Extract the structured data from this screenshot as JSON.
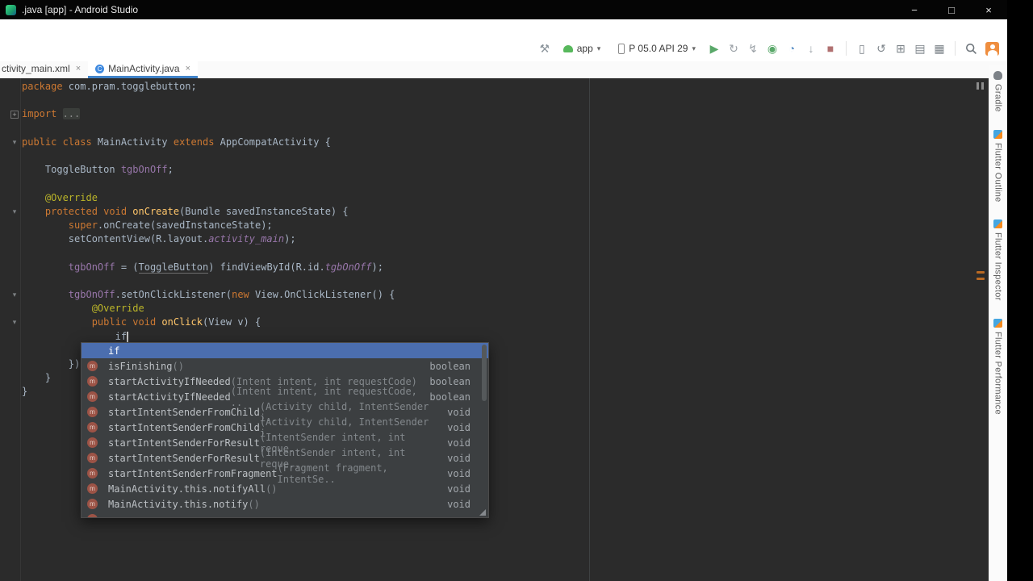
{
  "colors": {
    "editor_bg": "#2b2b2b",
    "popup_bg": "#3c3f41",
    "selection_blue": "#4b6eaf",
    "keyword_orange": "#cc7832",
    "field_purple": "#9876aa",
    "annotation_yellow": "#bbb529",
    "run_green": "#59a869",
    "tab_accent": "#4083c9"
  },
  "titlebar": {
    "title": ".java [app] - Android Studio",
    "minimize": "−",
    "maximize": "□",
    "close": "×"
  },
  "toolbar": {
    "dropdown_arrow": "▾",
    "run_config_label": "app",
    "device_label": "P 05.0 API 29",
    "build": [
      {
        "name": "build-icon",
        "glyph": "⚒",
        "color": "#8b949b"
      }
    ],
    "actions": [
      {
        "name": "run-button",
        "glyph": "▶",
        "color": "#59a869"
      },
      {
        "name": "apply-changes-button",
        "glyph": "↻",
        "color": "#9aa0a6"
      },
      {
        "name": "apply-code-changes-button",
        "glyph": "↯",
        "color": "#9aa0a6"
      },
      {
        "name": "debug-button",
        "glyph": "◉",
        "color": "#59a869"
      },
      {
        "name": "profile-button",
        "glyph": "◔",
        "color": "#6c9ccd"
      },
      {
        "name": "attach-debugger-button",
        "glyph": "↓",
        "color": "#9aa0a6"
      },
      {
        "name": "stop-button",
        "glyph": "■",
        "color": "#b07070"
      }
    ],
    "tools": [
      {
        "name": "avd-manager-button",
        "glyph": "▯",
        "color": "#7d848a"
      },
      {
        "name": "sync-project-button",
        "glyph": "↺",
        "color": "#7d848a"
      },
      {
        "name": "sdk-manager-button",
        "glyph": "⊞",
        "color": "#7d848a"
      },
      {
        "name": "layout-inspector-button",
        "glyph": "▤",
        "color": "#7d848a"
      },
      {
        "name": "resource-manager-button",
        "glyph": "▦",
        "color": "#7d848a"
      }
    ]
  },
  "tabs": [
    {
      "label": "ctivity_main.xml",
      "close": "×",
      "selected": false
    },
    {
      "label": "MainActivity.java",
      "close": "×",
      "selected": true,
      "icon": "java-class-icon",
      "icon_letter": "C"
    }
  ],
  "editor": {
    "lines": [
      [
        [
          "kw",
          "package "
        ],
        [
          "pl",
          "com.pram.togglebutton;"
        ]
      ],
      [],
      [
        [
          "kw",
          "import "
        ],
        [
          "fold",
          "..."
        ]
      ],
      [],
      [
        [
          "kw",
          "public class "
        ],
        [
          "pl",
          "MainActivity "
        ],
        [
          "kw",
          "extends "
        ],
        [
          "pl",
          "AppCompatActivity {"
        ]
      ],
      [],
      [
        [
          "pl",
          "    ToggleButton "
        ],
        [
          "fld",
          "tgbOnOff"
        ],
        [
          "pl",
          ";"
        ]
      ],
      [],
      [
        [
          "ann",
          "    @Override"
        ]
      ],
      [
        [
          "kw",
          "    protected void "
        ],
        [
          "mth",
          "onCreate"
        ],
        [
          "pl",
          "(Bundle savedInstanceState) {"
        ]
      ],
      [
        [
          "kw",
          "        super"
        ],
        [
          "pl",
          ".onCreate(savedInstanceState);"
        ]
      ],
      [
        [
          "pl",
          "        setContentView(R.layout."
        ],
        [
          "sf",
          "activity_main"
        ],
        [
          "pl",
          ");"
        ]
      ],
      [],
      [
        [
          "fld",
          "        tgbOnOff"
        ],
        [
          "pl",
          " = ("
        ],
        [
          "cast",
          "ToggleButton"
        ],
        [
          "pl",
          ") findViewById(R.id."
        ],
        [
          "sf",
          "tgbOnOff"
        ],
        [
          "pl",
          ");"
        ]
      ],
      [],
      [
        [
          "fld",
          "        tgbOnOff"
        ],
        [
          "pl",
          ".setOnClickListener("
        ],
        [
          "kw",
          "new "
        ],
        [
          "pl",
          "View.OnClickListener() {"
        ]
      ],
      [
        [
          "ann",
          "            @Override"
        ]
      ],
      [
        [
          "kw",
          "            public void "
        ],
        [
          "mth",
          "onClick"
        ],
        [
          "pl",
          "(View v) {"
        ]
      ],
      [
        [
          "pl",
          "                if"
        ],
        [
          "caret",
          ""
        ]
      ],
      [
        [
          "pl",
          "            }"
        ]
      ],
      [
        [
          "pl",
          "        });"
        ]
      ],
      [
        [
          "pl",
          "    }"
        ]
      ],
      [
        [
          "pl",
          "}"
        ]
      ]
    ],
    "folds": [
      {
        "line": 3,
        "kind": "plus"
      },
      {
        "line": 5,
        "kind": "arrow"
      },
      {
        "line": 10,
        "kind": "arrow"
      },
      {
        "line": 16,
        "kind": "arrow"
      },
      {
        "line": 18,
        "kind": "arrow"
      }
    ]
  },
  "completion": {
    "rows": [
      {
        "selected": true,
        "icon": "none",
        "name": "if",
        "params": "",
        "type": ""
      },
      {
        "selected": false,
        "icon": "method",
        "name": "isFinishing",
        "params": "()",
        "type": "boolean"
      },
      {
        "selected": false,
        "icon": "method",
        "name": "startActivityIfNeeded",
        "params": "(Intent intent, int requestCode)",
        "type": "boolean"
      },
      {
        "selected": false,
        "icon": "method",
        "name": "startActivityIfNeeded",
        "params": "(Intent intent, int requestCode, ..",
        "type": "boolean"
      },
      {
        "selected": false,
        "icon": "method",
        "name": "startIntentSenderFromChild",
        "params": "(Activity child, IntentSender i..",
        "type": "void"
      },
      {
        "selected": false,
        "icon": "method",
        "name": "startIntentSenderFromChild",
        "params": "(Activity child, IntentSender i..",
        "type": "void"
      },
      {
        "selected": false,
        "icon": "method",
        "name": "startIntentSenderForResult",
        "params": "(IntentSender intent, int reque..",
        "type": "void"
      },
      {
        "selected": false,
        "icon": "method",
        "name": "startIntentSenderForResult",
        "params": "(IntentSender intent, int reque..",
        "type": "void"
      },
      {
        "selected": false,
        "icon": "method",
        "name": "startIntentSenderFromFragment",
        "params": "(Fragment fragment, IntentSe..",
        "type": "void"
      },
      {
        "selected": false,
        "icon": "method",
        "name": "MainActivity.this.notifyAll",
        "params": "()",
        "type": "void"
      },
      {
        "selected": false,
        "icon": "method",
        "name": "MainActivity.this.notify",
        "params": "()",
        "type": "void"
      },
      {
        "selected": false,
        "icon": "method",
        "name": "",
        "params": "",
        "type": ""
      }
    ]
  },
  "tool_stripe": {
    "items": [
      {
        "label": "Gradle",
        "icon": "gradle-icon",
        "icon_class": "gradle"
      },
      {
        "label": "Flutter Outline",
        "icon": "flutter-icon",
        "icon_class": "flutter"
      },
      {
        "label": "Flutter Inspector",
        "icon": "flutter-icon",
        "icon_class": "flutter"
      },
      {
        "label": "Flutter Performance",
        "icon": "flutter-icon",
        "icon_class": "flutter"
      }
    ]
  }
}
